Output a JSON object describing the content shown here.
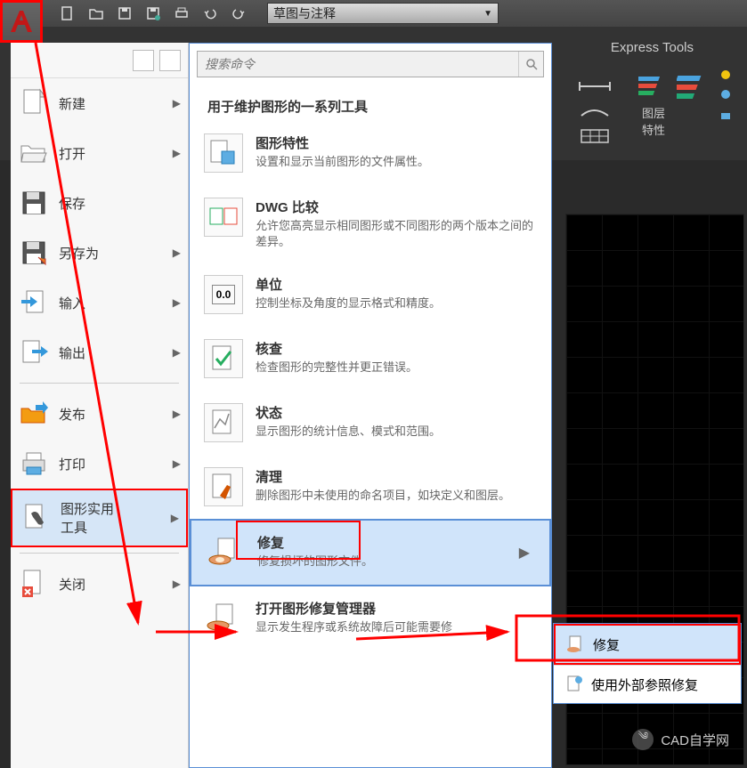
{
  "workspace": {
    "label": "草图与注释"
  },
  "ribbon": {
    "express_tools": "Express Tools",
    "layer_props": "图层\n特性"
  },
  "search": {
    "placeholder": "搜索命令"
  },
  "menu": {
    "items": [
      {
        "label": "新建"
      },
      {
        "label": "打开"
      },
      {
        "label": "保存"
      },
      {
        "label": "另存为"
      },
      {
        "label": "输入"
      },
      {
        "label": "输出"
      },
      {
        "label": "发布"
      },
      {
        "label": "打印"
      },
      {
        "label": "图形实用\n工具"
      },
      {
        "label": "关闭"
      }
    ]
  },
  "submenu": {
    "title": "用于维护图形的一系列工具",
    "items": [
      {
        "title": "图形特性",
        "desc": "设置和显示当前图形的文件属性。"
      },
      {
        "title": "DWG 比较",
        "desc": "允许您高亮显示相同图形或不同图形的两个版本之间的差异。"
      },
      {
        "title": "单位",
        "desc": "控制坐标及角度的显示格式和精度。"
      },
      {
        "title": "核查",
        "desc": "检查图形的完整性并更正错误。"
      },
      {
        "title": "状态",
        "desc": "显示图形的统计信息、模式和范围。"
      },
      {
        "title": "清理",
        "desc": "删除图形中未使用的命名项目，如块定义和图层。"
      },
      {
        "title": "修复",
        "desc": "修复损坏的图形文件。"
      },
      {
        "title": "打开图形修复管理器",
        "desc": "显示发生程序或系统故障后可能需要修"
      }
    ]
  },
  "flyout": {
    "items": [
      {
        "label": "修复"
      },
      {
        "label": "使用外部参照修复"
      }
    ]
  },
  "icon_text": {
    "units": "0.0"
  },
  "watermark": {
    "text": "CAD自学网"
  }
}
